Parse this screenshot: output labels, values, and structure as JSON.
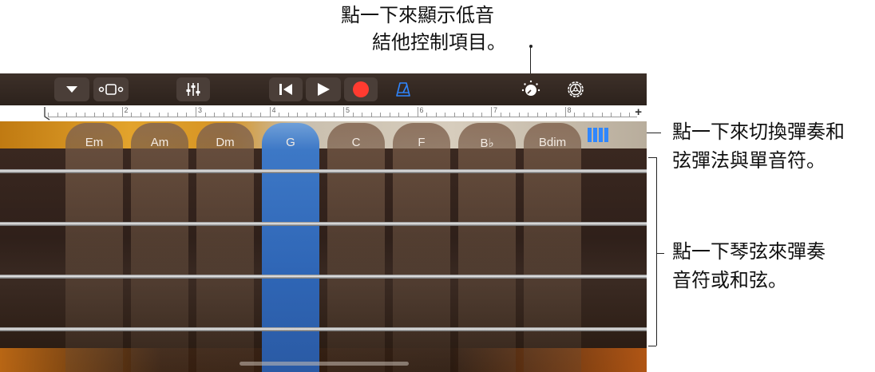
{
  "callouts": {
    "top_line1": "點一下來顯示低音",
    "top_line2": "結他控制項目。",
    "right1_line1": "點一下來切換彈奏和",
    "right1_line2": "弦彈法與單音符。",
    "right2_line1": "點一下琴弦來彈奏",
    "right2_line2": "音符或和弦。"
  },
  "toolbar": {
    "buttons": [
      {
        "name": "browser-dropdown",
        "icon": "triangle-down-icon"
      },
      {
        "name": "tracks-view",
        "icon": "tracks-view-icon"
      },
      {
        "name": "mixer",
        "icon": "mixer-sliders-icon"
      },
      {
        "name": "go-to-beginning",
        "icon": "skip-back-icon"
      },
      {
        "name": "play",
        "icon": "play-icon"
      },
      {
        "name": "record",
        "icon": "record-icon"
      },
      {
        "name": "metronome",
        "icon": "metronome-icon"
      },
      {
        "name": "controls",
        "icon": "knob-icon"
      },
      {
        "name": "settings",
        "icon": "gear-icon"
      }
    ],
    "record_color": "#ff3b30",
    "metronome_color": "#2f86ff"
  },
  "ruler": {
    "bars": [
      "2",
      "3",
      "4",
      "5",
      "6",
      "7",
      "8"
    ],
    "plus": "+"
  },
  "chords": [
    "Em",
    "Am",
    "Dm",
    "G",
    "C",
    "F",
    "B♭",
    "Bdim"
  ],
  "active_chord": "G",
  "colors": {
    "active_chord": "#3d78c6",
    "mode_button": "#2f86ff"
  }
}
